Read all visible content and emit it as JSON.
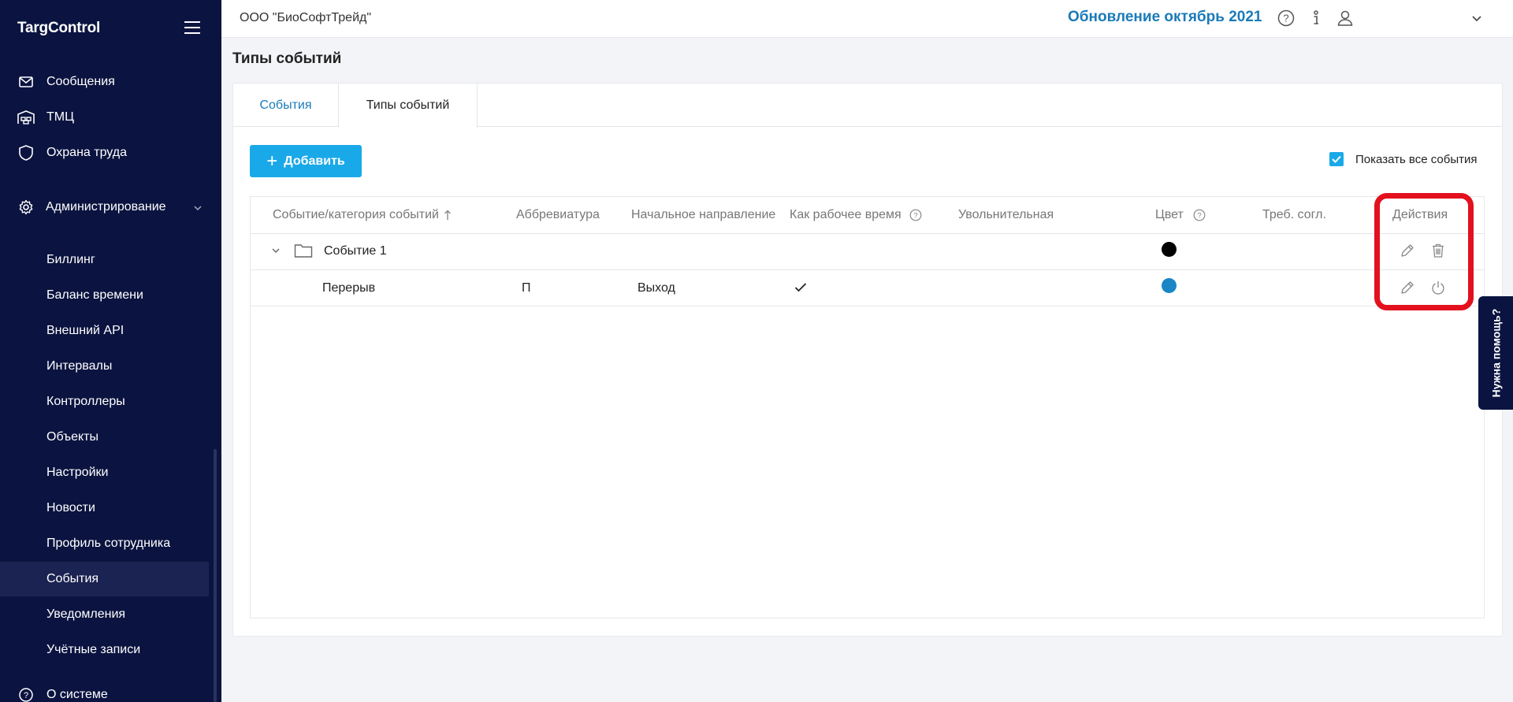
{
  "app": {
    "logo": "TargControl"
  },
  "sidebar": {
    "top_items": [
      {
        "label": "Сообщения",
        "icon": "mail-icon"
      },
      {
        "label": "ТМЦ",
        "icon": "warehouse-icon"
      },
      {
        "label": "Охрана труда",
        "icon": "shield-icon"
      }
    ],
    "admin": {
      "label": "Администрирование",
      "icon": "gear-icon",
      "expanded": true
    },
    "sub_items": [
      {
        "label": "Биллинг"
      },
      {
        "label": "Баланс времени"
      },
      {
        "label": "Внешний API"
      },
      {
        "label": "Интервалы"
      },
      {
        "label": "Контроллеры"
      },
      {
        "label": "Объекты"
      },
      {
        "label": "Настройки"
      },
      {
        "label": "Новости"
      },
      {
        "label": "Профиль сотрудника"
      },
      {
        "label": "События",
        "active": true
      },
      {
        "label": "Уведомления"
      },
      {
        "label": "Учётные записи"
      }
    ],
    "bottom_item": {
      "label": "О системе",
      "icon": "help-circle-icon"
    }
  },
  "topbar": {
    "org": "ООО \"БиоСофтТрейд\"",
    "update": "Обновление октябрь 2021"
  },
  "page": {
    "title": "Типы событий"
  },
  "tabs": [
    {
      "label": "События",
      "active": false
    },
    {
      "label": "Типы событий",
      "active": true
    }
  ],
  "toolbar": {
    "add_label": "Добавить",
    "show_all_label": "Показать все события",
    "show_all_checked": true
  },
  "table": {
    "columns": {
      "event": "Событие/категория событий",
      "abbr": "Аббревиатура",
      "direction": "Начальное направление",
      "worktime": "Как рабочее время",
      "dismissal": "Увольнительная",
      "color": "Цвет",
      "approval": "Треб. согл.",
      "actions": "Действия"
    },
    "rows": [
      {
        "type": "category",
        "name": "Событие 1",
        "color": "#000000"
      },
      {
        "type": "event",
        "name": "Перерыв",
        "abbr": "П",
        "direction": "Выход",
        "worktime": true,
        "color": "#1a86c6"
      }
    ]
  },
  "help_tab": "Нужна помощь?",
  "colors": {
    "sidebar": "#0b1440",
    "accent": "#1aa9e8",
    "link": "#1a7bb8",
    "highlight": "#e3101e"
  }
}
